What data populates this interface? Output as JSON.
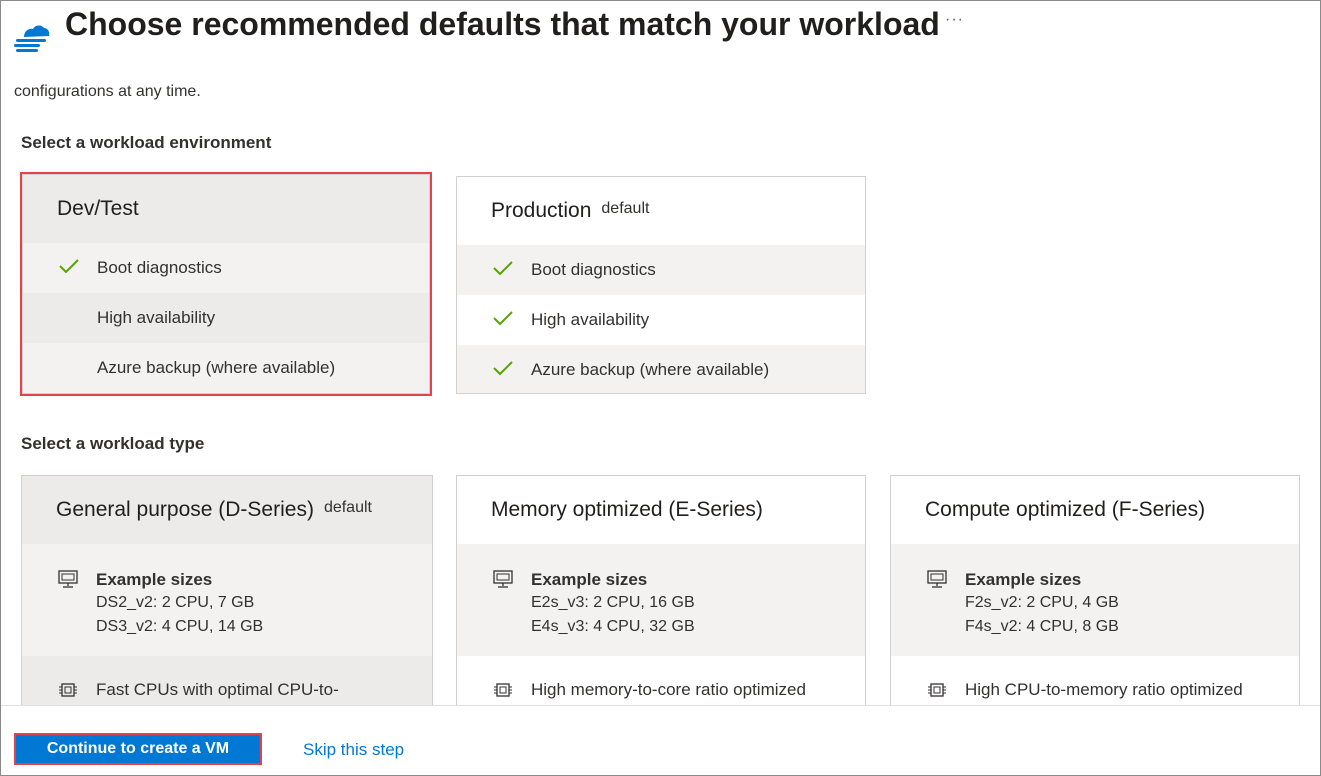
{
  "header": {
    "title": "Choose recommended defaults that match your workload",
    "more_label": "···",
    "logo_icon": "cloud-icon"
  },
  "intro_text": "configurations at any time.",
  "environment": {
    "label": "Select a workload environment",
    "cards": [
      {
        "title": "Dev/Test",
        "badge": "",
        "selected": true,
        "features": [
          {
            "label": "Boot diagnostics",
            "checked": true
          },
          {
            "label": "High availability",
            "checked": false
          },
          {
            "label": "Azure backup (where available)",
            "checked": false
          }
        ]
      },
      {
        "title": "Production",
        "badge": "default",
        "selected": false,
        "features": [
          {
            "label": "Boot diagnostics",
            "checked": true
          },
          {
            "label": "High availability",
            "checked": true
          },
          {
            "label": "Azure backup (where available)",
            "checked": true
          }
        ]
      }
    ]
  },
  "workload_type": {
    "label": "Select a workload type",
    "cards": [
      {
        "title": "General purpose (D-Series)",
        "badge": "default",
        "selected": true,
        "sizes_title": "Example sizes",
        "sizes": [
          "DS2_v2: 2 CPU, 7 GB",
          "DS3_v2: 4 CPU, 14 GB"
        ],
        "description": "Fast CPUs with optimal CPU-to-"
      },
      {
        "title": "Memory optimized (E-Series)",
        "badge": "",
        "selected": false,
        "sizes_title": "Example sizes",
        "sizes": [
          "E2s_v3: 2 CPU, 16 GB",
          "E4s_v3: 4 CPU, 32 GB"
        ],
        "description": "High memory-to-core ratio optimized"
      },
      {
        "title": "Compute optimized (F-Series)",
        "badge": "",
        "selected": false,
        "sizes_title": "Example sizes",
        "sizes": [
          "F2s_v2: 2 CPU, 4 GB",
          "F4s_v2: 4 CPU, 8 GB"
        ],
        "description": "High CPU-to-memory ratio optimized"
      }
    ]
  },
  "footer": {
    "primary_label": "Continue to create a VM",
    "skip_label": "Skip this step"
  },
  "colors": {
    "accent": "#0078d4",
    "check": "#57a300",
    "highlight": "#e3434a"
  }
}
